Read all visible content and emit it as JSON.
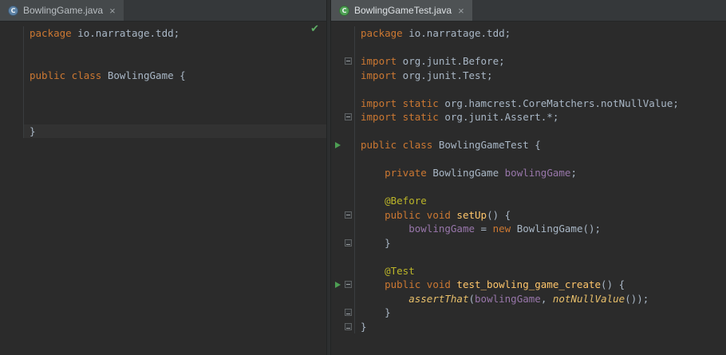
{
  "icons": {
    "run": "play-triangle",
    "fold": "minus-box",
    "fold_end": "minus-box-bottom",
    "close": "×",
    "status_ok": "✔",
    "class_icon_letter": "C"
  },
  "colors": {
    "editor_bg": "#2b2b2b",
    "keyword": "#cc7832",
    "plain_text": "#a9b7c6",
    "field": "#9876aa",
    "annotation": "#bbb529",
    "method_decl": "#ffc66b",
    "static_call_italic": "#e8bf6a",
    "run_green": "#4d9e53",
    "check_green": "#5fad65",
    "class_icon": "#5d82a5",
    "test_icon": "#4fa154"
  },
  "panes": [
    {
      "tab": {
        "label": "BowlingGame.java",
        "icon_letter": "C",
        "icon_kind": "class",
        "close_label": "×",
        "active": false
      },
      "status_icon": "✔",
      "lines": [
        {
          "g": "",
          "s": [
            [
              "kw",
              "package"
            ],
            [
              "plain",
              " io.narratage.tdd;"
            ]
          ]
        },
        {
          "g": "",
          "s": []
        },
        {
          "g": "",
          "s": []
        },
        {
          "g": "",
          "s": [
            [
              "kw",
              "public class "
            ],
            [
              "plain",
              "BowlingGame {"
            ]
          ]
        },
        {
          "g": "",
          "s": []
        },
        {
          "g": "",
          "s": []
        },
        {
          "g": "",
          "s": []
        },
        {
          "g": "",
          "a": true,
          "s": [
            [
              "plain",
              "}"
            ]
          ]
        }
      ]
    },
    {
      "tab": {
        "label": "BowlingGameTest.java",
        "icon_letter": "C",
        "icon_kind": "test",
        "close_label": "×",
        "active": true
      },
      "status_icon": "",
      "lines": [
        {
          "g": "",
          "s": [
            [
              "kw",
              "package"
            ],
            [
              "plain",
              " io.narratage.tdd;"
            ]
          ]
        },
        {
          "g": "",
          "s": []
        },
        {
          "g": "fold",
          "s": [
            [
              "kw",
              "import"
            ],
            [
              "plain",
              " org.junit.Before;"
            ]
          ]
        },
        {
          "g": "",
          "s": [
            [
              "kw",
              "import"
            ],
            [
              "plain",
              " org.junit.Test;"
            ]
          ]
        },
        {
          "g": "",
          "s": []
        },
        {
          "g": "",
          "s": [
            [
              "kw",
              "import static"
            ],
            [
              "plain",
              " org.hamcrest.CoreMatchers.notNullValue;"
            ]
          ]
        },
        {
          "g": "fold",
          "s": [
            [
              "kw",
              "import static"
            ],
            [
              "plain",
              " org.junit.Assert.*;"
            ]
          ]
        },
        {
          "g": "",
          "s": []
        },
        {
          "g": "run",
          "s": [
            [
              "kw",
              "public class "
            ],
            [
              "plain",
              "BowlingGameTest {"
            ]
          ]
        },
        {
          "g": "",
          "s": []
        },
        {
          "g": "",
          "s": [
            [
              "plain",
              "    "
            ],
            [
              "kw",
              "private "
            ],
            [
              "plain",
              "BowlingGame "
            ],
            [
              "field",
              "bowlingGame"
            ],
            [
              "plain",
              ";"
            ]
          ]
        },
        {
          "g": "",
          "s": []
        },
        {
          "g": "",
          "s": [
            [
              "plain",
              "    "
            ],
            [
              "ann",
              "@Before"
            ]
          ]
        },
        {
          "g": "fold",
          "s": [
            [
              "plain",
              "    "
            ],
            [
              "kw",
              "public void "
            ],
            [
              "decl",
              "setUp"
            ],
            [
              "plain",
              "() {"
            ]
          ]
        },
        {
          "g": "",
          "s": [
            [
              "plain",
              "        "
            ],
            [
              "field",
              "bowlingGame"
            ],
            [
              "plain",
              " = "
            ],
            [
              "kw",
              "new "
            ],
            [
              "plain",
              "BowlingGame();"
            ]
          ]
        },
        {
          "g": "fold-end",
          "s": [
            [
              "plain",
              "    }"
            ]
          ]
        },
        {
          "g": "",
          "s": []
        },
        {
          "g": "",
          "s": [
            [
              "plain",
              "    "
            ],
            [
              "ann",
              "@Test"
            ]
          ]
        },
        {
          "g": "run-fold",
          "s": [
            [
              "plain",
              "    "
            ],
            [
              "kw",
              "public void "
            ],
            [
              "decl",
              "test_bowling_game_create"
            ],
            [
              "plain",
              "() {"
            ]
          ]
        },
        {
          "g": "",
          "s": [
            [
              "plain",
              "        "
            ],
            [
              "call",
              "assertThat"
            ],
            [
              "plain",
              "("
            ],
            [
              "field",
              "bowlingGame"
            ],
            [
              "plain",
              ", "
            ],
            [
              "call",
              "notNullValue"
            ],
            [
              "plain",
              "());"
            ]
          ]
        },
        {
          "g": "fold-end",
          "s": [
            [
              "plain",
              "    }"
            ]
          ]
        },
        {
          "g": "fold-end",
          "s": [
            [
              "plain",
              "}"
            ]
          ]
        }
      ]
    }
  ]
}
